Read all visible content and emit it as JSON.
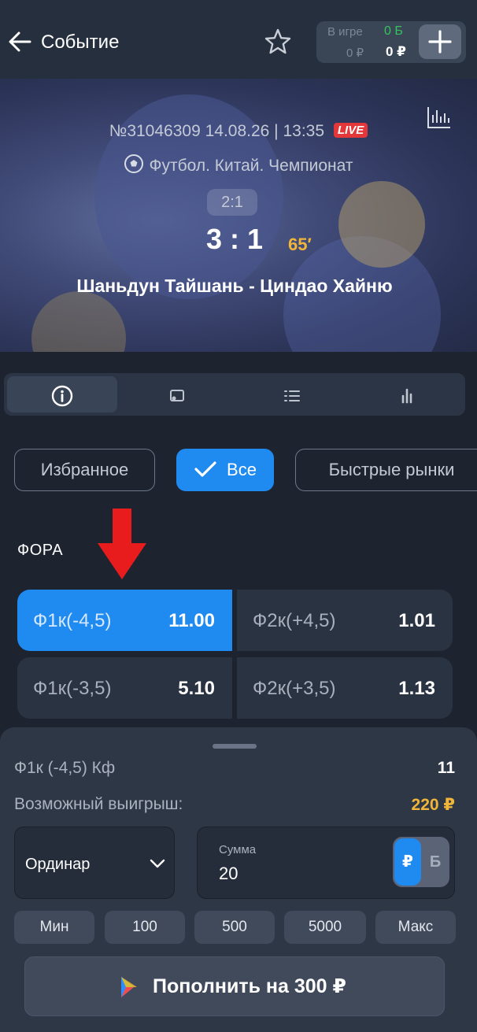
{
  "header": {
    "title": "Событие",
    "balance": {
      "in_game_label": "В игре",
      "in_game_value": "0 ₽",
      "bonus_value": "0 Б",
      "real_value": "0 ₽"
    }
  },
  "event": {
    "id_datetime": "№31046309 14.08.26 | 13:35",
    "live_badge": "LIVE",
    "sport_line": "Футбол. Китай. Чемпионат",
    "half_score": "2:1",
    "score": "3 : 1",
    "minute": "65′",
    "teams": "Шаньдун Тайшань - Циндао Хайню"
  },
  "tabs": [
    {
      "icon": "info-icon",
      "active": true
    },
    {
      "icon": "tv-icon",
      "active": false
    },
    {
      "icon": "list-icon",
      "active": false
    },
    {
      "icon": "bar-chart-icon",
      "active": false
    }
  ],
  "filters": {
    "favorites": "Избранное",
    "all": "Все",
    "quick": "Быстрые рынки"
  },
  "market": {
    "title": "ФОРА",
    "odds": [
      {
        "label": "Ф1к(-4,5)",
        "value": "11.00",
        "selected": true
      },
      {
        "label": "Ф2к(+4,5)",
        "value": "1.01",
        "selected": false
      },
      {
        "label": "Ф1к(-3,5)",
        "value": "5.10",
        "selected": false
      },
      {
        "label": "Ф2к(+3,5)",
        "value": "1.13",
        "selected": false
      }
    ]
  },
  "slip": {
    "bet_label": "Ф1к (-4,5) Кф",
    "coef": "11",
    "win_label": "Возможный выигрыш:",
    "win_value": "220 ₽",
    "bet_type": "Ординар",
    "amount_label": "Сумма",
    "amount_value": "20",
    "currency_rub": "₽",
    "currency_bonus": "Б",
    "quick_amounts": [
      "Мин",
      "100",
      "500",
      "5000",
      "Макс"
    ],
    "deposit_label": "Пополнить на 300 ₽"
  },
  "colors": {
    "accent": "#1f8af0",
    "win": "#f1b53a",
    "live": "#e4373a",
    "bonus": "#35c35f",
    "arrow": "#e81c1c"
  }
}
